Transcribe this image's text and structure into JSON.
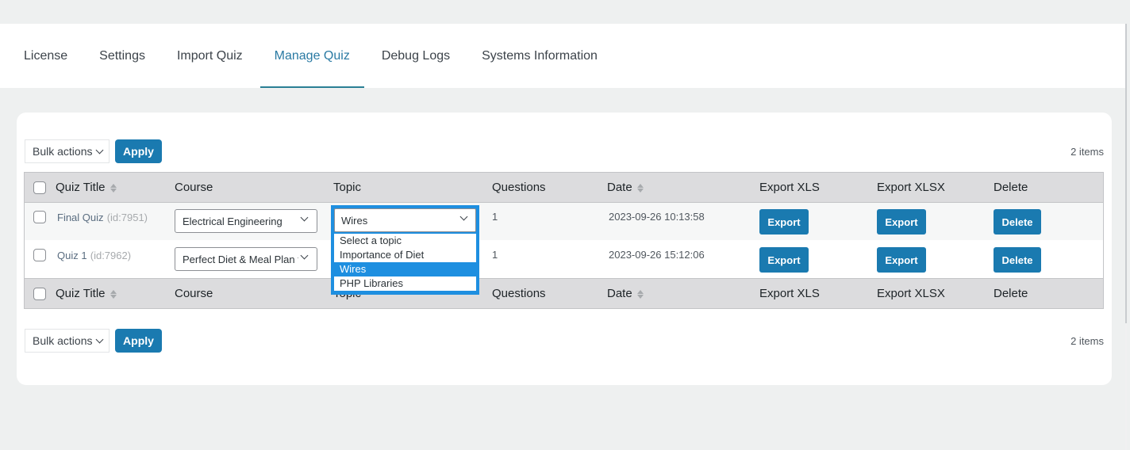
{
  "nav": {
    "tabs": [
      {
        "label": "License",
        "active": false
      },
      {
        "label": "Settings",
        "active": false
      },
      {
        "label": "Import Quiz",
        "active": false
      },
      {
        "label": "Manage Quiz",
        "active": true
      },
      {
        "label": "Debug Logs",
        "active": false
      },
      {
        "label": "Systems Information",
        "active": false
      }
    ]
  },
  "toolbar_top": {
    "bulk_label": "Bulk actions",
    "apply_label": "Apply",
    "items_count": "2 items"
  },
  "toolbar_bottom": {
    "bulk_label": "Bulk actions",
    "apply_label": "Apply",
    "items_count": "2 items"
  },
  "table": {
    "columns": [
      "Quiz Title",
      "Course",
      "Topic",
      "Questions",
      "Date",
      "Export XLS",
      "Export XLSX",
      "Delete"
    ],
    "rows": [
      {
        "title": "Final Quiz",
        "id": "(id:7951)",
        "course": "Electrical Engineering",
        "topic": "Wires",
        "questions": "1",
        "date": "2023-09-26 10:13:58",
        "export_xls": "Export",
        "export_xlsx": "Export",
        "delete": "Delete"
      },
      {
        "title": "Quiz 1",
        "id": "(id:7962)",
        "course": "Perfect Diet & Meal Plan for Weight Loss",
        "topic": "",
        "questions": "1",
        "date": "2023-09-26 15:12:06",
        "export_xls": "Export",
        "export_xlsx": "Export",
        "delete": "Delete"
      }
    ]
  },
  "topic_dropdown": {
    "selected": "Wires",
    "options": [
      "Select a topic",
      "Importance of Diet",
      "Wires",
      "PHP Libraries"
    ],
    "highlighted": "Wires"
  },
  "colors": {
    "accent": "#1a7ab0",
    "active_tab": "#2a7aa3",
    "dropdown_highlight": "#1e8fe0"
  }
}
